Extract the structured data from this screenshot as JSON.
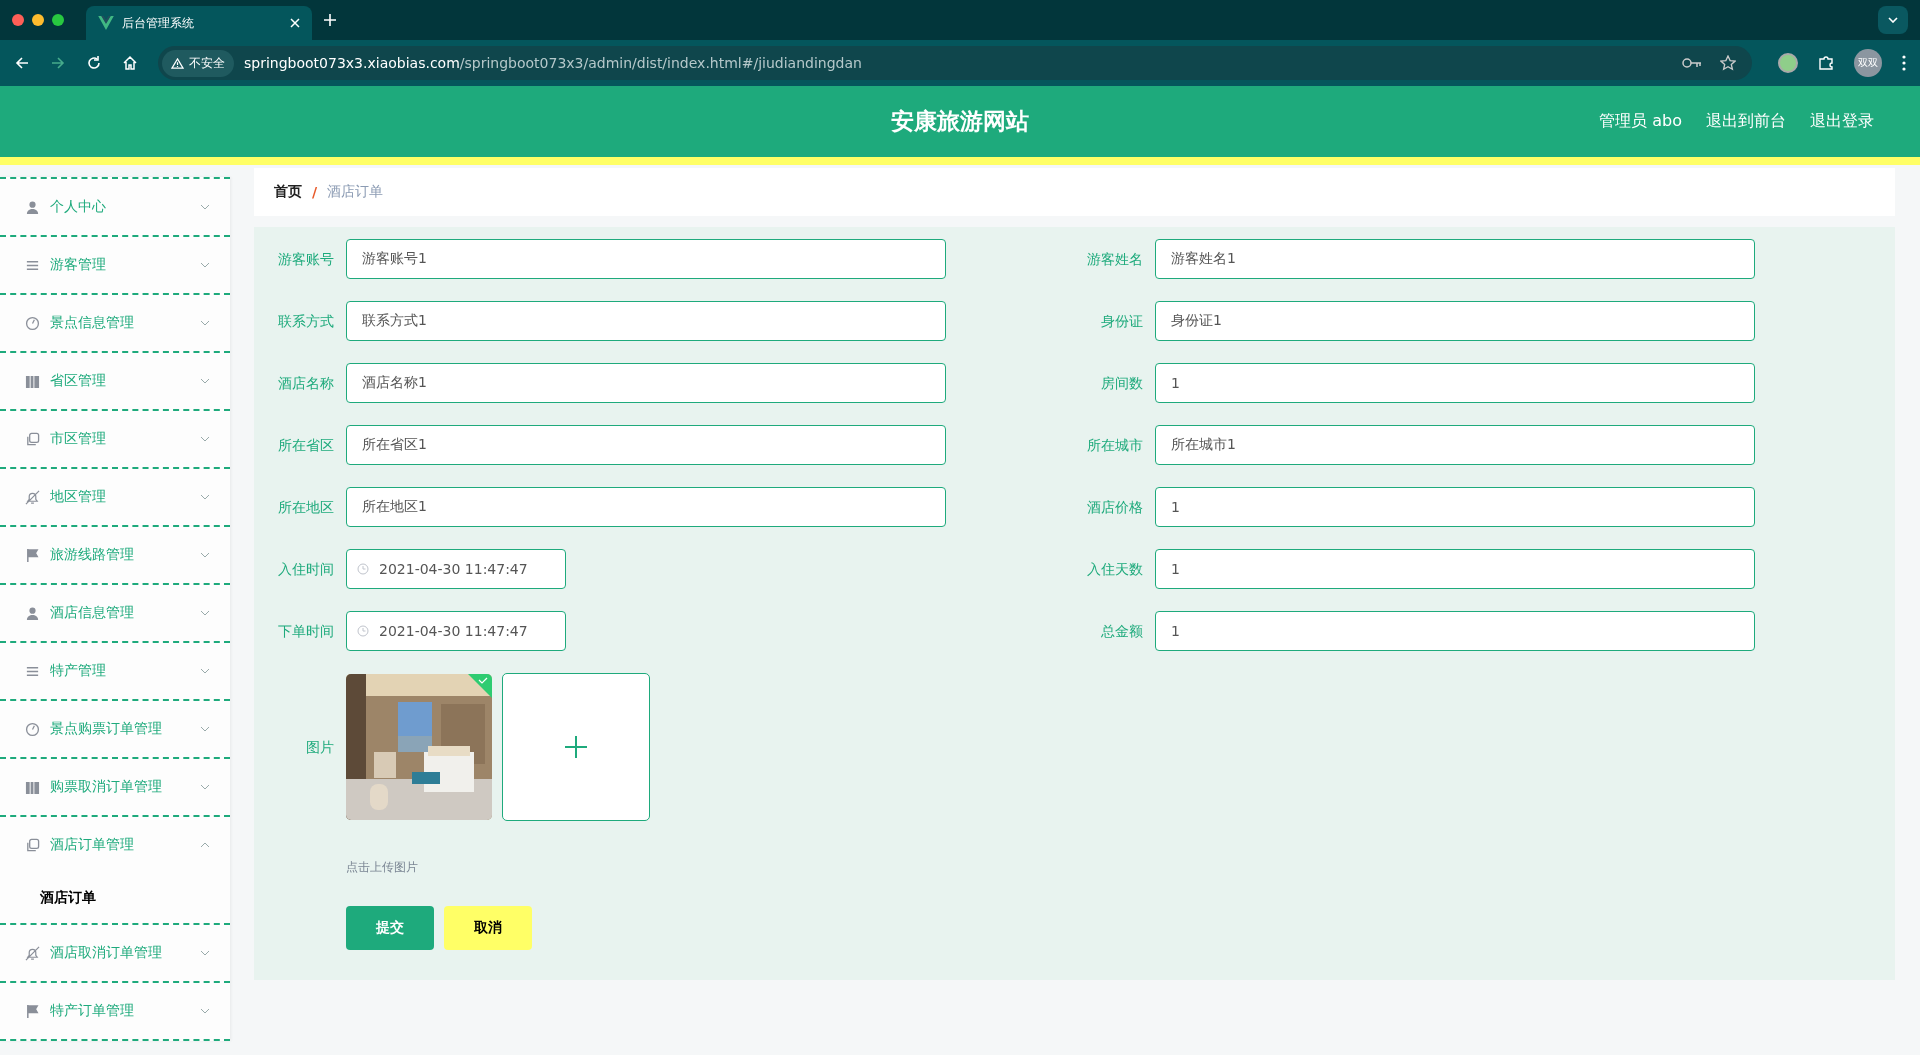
{
  "browser": {
    "tab_title": "后台管理系统",
    "security": "不安全",
    "url_host": "springboot073x3.xiaobias.com",
    "url_path": "/springboot073x3/admin/dist/index.html#/jiudiandingdan",
    "avatar": "双双"
  },
  "header": {
    "title": "安康旅游网站",
    "user": "管理员 abo",
    "links": [
      "退出到前台",
      "退出登录"
    ]
  },
  "sidebar": {
    "items": [
      {
        "label": "个人中心",
        "expanded": false
      },
      {
        "label": "游客管理",
        "expanded": false
      },
      {
        "label": "景点信息管理",
        "expanded": false
      },
      {
        "label": "省区管理",
        "expanded": false
      },
      {
        "label": "市区管理",
        "expanded": false
      },
      {
        "label": "地区管理",
        "expanded": false
      },
      {
        "label": "旅游线路管理",
        "expanded": false
      },
      {
        "label": "酒店信息管理",
        "expanded": false
      },
      {
        "label": "特产管理",
        "expanded": false
      },
      {
        "label": "景点购票订单管理",
        "expanded": false
      },
      {
        "label": "购票取消订单管理",
        "expanded": false
      },
      {
        "label": "酒店订单管理",
        "expanded": true,
        "children": [
          {
            "label": "酒店订单",
            "selected": true
          }
        ]
      },
      {
        "label": "酒店取消订单管理",
        "expanded": false
      },
      {
        "label": "特产订单管理",
        "expanded": false
      }
    ]
  },
  "breadcrumb": {
    "separator": "/",
    "items": [
      "首页",
      "酒店订单"
    ]
  },
  "form": {
    "rows": [
      {
        "left": {
          "kind": "text",
          "label": "游客账号",
          "value": "游客账号1"
        },
        "right": {
          "kind": "text",
          "label": "游客姓名",
          "value": "游客姓名1"
        }
      },
      {
        "left": {
          "kind": "text",
          "label": "联系方式",
          "value": "联系方式1"
        },
        "right": {
          "kind": "text",
          "label": "身份证",
          "value": "身份证1"
        }
      },
      {
        "left": {
          "kind": "text",
          "label": "酒店名称",
          "value": "酒店名称1"
        },
        "right": {
          "kind": "text",
          "label": "房间数",
          "value": "1"
        }
      },
      {
        "left": {
          "kind": "text",
          "label": "所在省区",
          "value": "所在省区1"
        },
        "right": {
          "kind": "text",
          "label": "所在城市",
          "value": "所在城市1"
        }
      },
      {
        "left": {
          "kind": "text",
          "label": "所在地区",
          "value": "所在地区1"
        },
        "right": {
          "kind": "text",
          "label": "酒店价格",
          "value": "1"
        }
      },
      {
        "left": {
          "kind": "date",
          "label": "入住时间",
          "value": "2021-04-30 11:47:47"
        },
        "right": {
          "kind": "text",
          "label": "入住天数",
          "value": "1"
        }
      },
      {
        "left": {
          "kind": "date",
          "label": "下单时间",
          "value": "2021-04-30 11:47:47"
        },
        "right": {
          "kind": "text",
          "label": "总金额",
          "value": "1"
        }
      }
    ],
    "image": {
      "label": "图片",
      "uploaded": true,
      "hint": "点击上传图片"
    },
    "buttons": [
      {
        "kind": "primary",
        "label": "提交"
      },
      {
        "kind": "cancel",
        "label": "取消"
      }
    ]
  }
}
